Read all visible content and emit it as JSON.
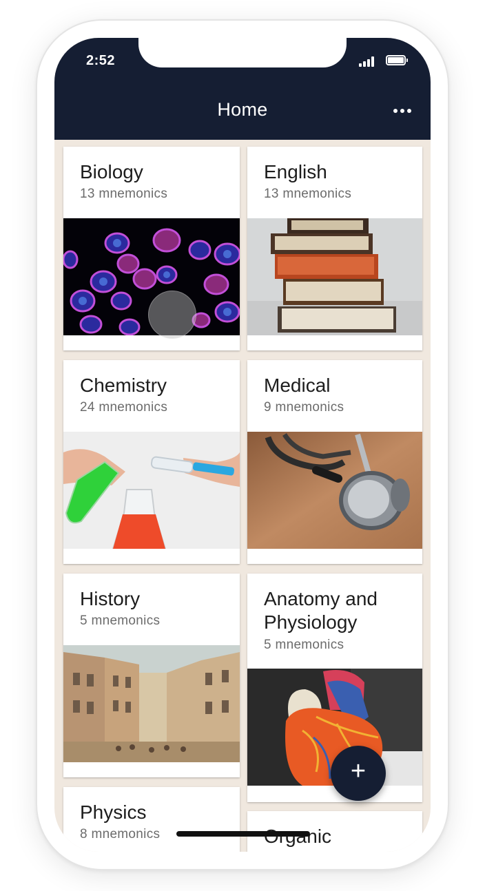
{
  "status_bar": {
    "time": "2:52"
  },
  "header": {
    "title": "Home",
    "more_icon": "more-horizontal-icon"
  },
  "categories": [
    {
      "title": "Biology",
      "count": "13 mnemonics",
      "image": "fluorescent-cells"
    },
    {
      "title": "English",
      "count": "13 mnemonics",
      "image": "stack-of-books"
    },
    {
      "title": "Chemistry",
      "count": "24 mnemonics",
      "image": "lab-flasks"
    },
    {
      "title": "Medical",
      "count": "9 mnemonics",
      "image": "stethoscope"
    },
    {
      "title": "History",
      "count": "5 mnemonics",
      "image": "old-street-painting"
    },
    {
      "title": "Anatomy and Physiology",
      "count": "5 mnemonics",
      "image": "heart-model"
    },
    {
      "title": "Physics",
      "count": "8 mnemonics"
    },
    {
      "title": "Organic"
    }
  ],
  "fab": {
    "label": "+",
    "icon": "plus-icon"
  },
  "colors": {
    "header": "#151e33",
    "background": "#f0e8df",
    "fab": "#151e33"
  }
}
